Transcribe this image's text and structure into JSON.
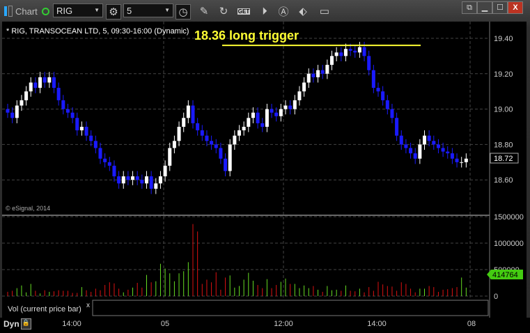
{
  "toolbar": {
    "title": "Chart",
    "symbol": "RIG",
    "interval": "5",
    "get_label": "GET"
  },
  "window_controls": {
    "restore": "⧉",
    "minimize": "▁",
    "maximize": "☐",
    "close": "X"
  },
  "chart": {
    "header": "* RIG, TRANSOCEAN LTD, 5, 09:30-16:00 (Dynamic)",
    "annotation": "18.36 long trigger",
    "copyright": "© eSignal, 2014",
    "price_ticks": [
      "19.40",
      "19.20",
      "19.00",
      "18.80",
      "18.60"
    ],
    "price_tick_values": [
      19.4,
      19.2,
      19.0,
      18.8,
      18.6
    ],
    "last_price": "18.72",
    "vol_ticks": [
      "1500000",
      "1000000",
      "500000",
      "0"
    ],
    "vol_tick_values": [
      1500000,
      1000000,
      500000,
      0
    ],
    "last_volume": "414764",
    "vol_label": "Vol (current price bar)",
    "close_x": "x",
    "time_labels": [
      "14:00",
      "05",
      "12:00",
      "14:00",
      "08"
    ],
    "dyn_label": "Dyn",
    "colors": {
      "up": "#ffffff",
      "down": "#1a1aff",
      "vol_up": "#66dd22",
      "vol_down": "#dd1111",
      "trigger": "#ffff33"
    }
  },
  "chart_data": {
    "type": "candlestick",
    "trigger_level": 19.36,
    "closes": [
      18.98,
      18.95,
      19.02,
      19.05,
      19.1,
      19.15,
      19.12,
      19.18,
      19.15,
      19.18,
      19.12,
      19.05,
      19.0,
      18.98,
      18.95,
      18.88,
      18.9,
      18.85,
      18.82,
      18.78,
      18.72,
      18.7,
      18.68,
      18.62,
      18.58,
      18.62,
      18.6,
      18.62,
      18.6,
      18.58,
      18.62,
      18.55,
      18.58,
      18.62,
      18.68,
      18.78,
      18.82,
      18.9,
      18.95,
      19.02,
      18.92,
      18.88,
      18.85,
      18.82,
      18.8,
      18.78,
      18.72,
      18.65,
      18.8,
      18.85,
      18.88,
      18.9,
      18.95,
      18.98,
      18.92,
      18.9,
      19.0,
      18.98,
      18.96,
      19.0,
      19.02,
      19.0,
      19.05,
      19.1,
      19.15,
      19.2,
      19.18,
      19.22,
      19.2,
      19.25,
      19.3,
      19.32,
      19.3,
      19.34,
      19.33,
      19.32,
      19.35,
      19.3,
      19.22,
      19.12,
      19.1,
      19.05,
      19.0,
      18.95,
      18.85,
      18.8,
      18.78,
      18.75,
      18.72,
      18.8,
      18.85,
      18.82,
      18.8,
      18.78,
      18.76,
      18.75,
      18.72,
      18.7,
      18.7,
      18.72
    ],
    "volumes": [
      80000,
      100000,
      150000,
      200000,
      70000,
      230000,
      100000,
      50000,
      110000,
      80000,
      90000,
      110000,
      100000,
      100000,
      60000,
      60000,
      170000,
      110000,
      80000,
      140000,
      110000,
      210000,
      260000,
      240000,
      140000,
      70000,
      120000,
      160000,
      250000,
      160000,
      400000,
      260000,
      280000,
      610000,
      520000,
      430000,
      280000,
      430000,
      470000,
      640000,
      1360000,
      1220000,
      230000,
      310000,
      260000,
      450000,
      120000,
      350000,
      390000,
      160000,
      190000,
      310000,
      440000,
      290000,
      210000,
      150000,
      320000,
      150000,
      210000,
      270000,
      330000,
      230000,
      230000,
      150000,
      200000,
      150000,
      190000,
      120000,
      80000,
      190000,
      110000,
      120000,
      100000,
      200000,
      100000,
      90000,
      140000,
      70000,
      170000,
      100000,
      270000,
      220000,
      190000,
      180000,
      100000,
      260000,
      230000,
      140000,
      70000,
      140000,
      140000,
      190000,
      170000,
      80000,
      120000,
      130000,
      150000,
      170000,
      350000,
      160000
    ]
  }
}
